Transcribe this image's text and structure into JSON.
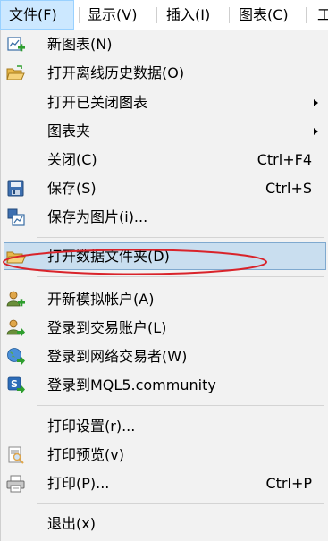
{
  "menubar": {
    "items": [
      {
        "label": "文件(F)"
      },
      {
        "label": "显示(V)"
      },
      {
        "label": "插入(I)"
      },
      {
        "label": "图表(C)"
      },
      {
        "label": "工"
      }
    ]
  },
  "menu": {
    "items": [
      {
        "label": "新图表(N)",
        "icon": "new-chart-icon"
      },
      {
        "label": "打开离线历史数据(O)",
        "icon": "open-folder-icon"
      },
      {
        "label": "打开已关闭图表"
      },
      {
        "label": "图表夹"
      },
      {
        "label": "关闭(C)",
        "shortcut": "Ctrl+F4"
      },
      {
        "label": "保存(S)",
        "shortcut": "Ctrl+S",
        "icon": "save-icon"
      },
      {
        "label": "保存为图片(i)...",
        "icon": "save-picture-icon"
      },
      {
        "label": "打开数据文件夹(D)",
        "icon": "folder-icon"
      },
      {
        "label": "开新模拟帐户(A)",
        "icon": "add-user-icon"
      },
      {
        "label": "登录到交易账户(L)",
        "icon": "login-account-icon"
      },
      {
        "label": "登录到网络交易者(W)",
        "icon": "web-trader-icon"
      },
      {
        "label": "登录到MQL5.community",
        "icon": "mql5-icon"
      },
      {
        "label": "打印设置(r)..."
      },
      {
        "label": "打印预览(v)",
        "icon": "print-preview-icon"
      },
      {
        "label": "打印(P)...",
        "shortcut": "Ctrl+P",
        "icon": "printer-icon"
      },
      {
        "label": "退出(x)"
      }
    ]
  },
  "colors": {
    "highlight": "#c9deef",
    "annotation_ellipse": "#d9232a"
  }
}
